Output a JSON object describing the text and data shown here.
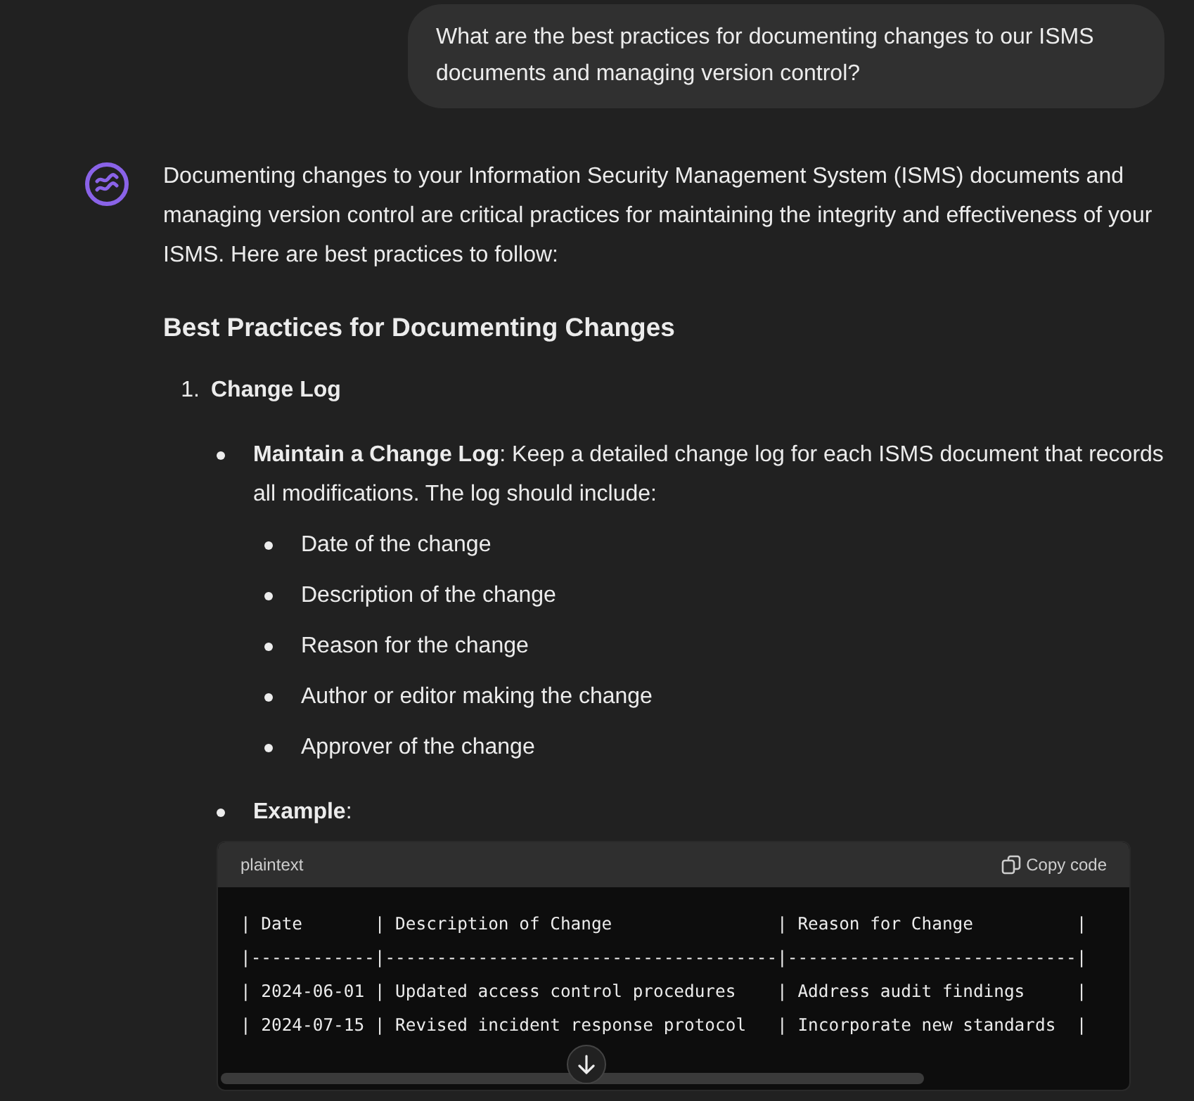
{
  "user_message": "What are the best practices for documenting changes to our ISMS documents and managing version control?",
  "assistant": {
    "intro": "Documenting changes to your Information Security Management System (ISMS) documents and managing version control are critical practices for maintaining the integrity and effectiveness of your ISMS. Here are best practices to follow:",
    "heading": "Best Practices for Documenting Changes",
    "sections": [
      {
        "number": "1.",
        "title": "Change Log",
        "bullets": [
          {
            "kind": "text",
            "text": "**Maintain a Change Log**: Keep a detailed change log for each ISMS document that records all modifications. The log should include:",
            "items": [
              "Date of the change",
              "Description of the change",
              "Reason for the change",
              "Author or editor making the change",
              "Approver of the change"
            ]
          },
          {
            "kind": "code",
            "text": "**Example**:",
            "code": {
              "language": "plaintext",
              "copy_label": "Copy code",
              "lines": [
                "| Date       | Description of Change                | Reason for Change          |",
                "|------------|--------------------------------------|----------------------------|",
                "| 2024-06-01 | Updated access control procedures    | Address audit findings     |",
                "| 2024-07-15 | Revised incident response protocol   | Incorporate new standards  |"
              ]
            }
          }
        ]
      }
    ]
  }
}
